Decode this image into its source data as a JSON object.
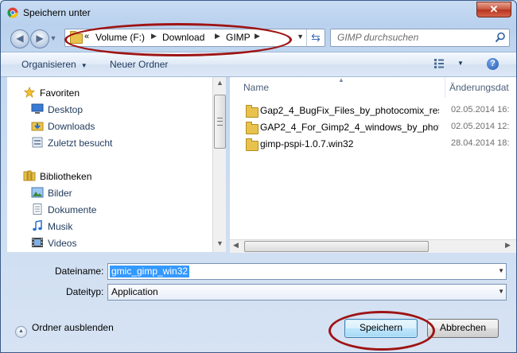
{
  "window": {
    "title": "Speichern unter",
    "close_label": "✕"
  },
  "address": {
    "overflow": "«",
    "crumbs": [
      "Volume (F:)",
      "Download",
      "GIMP"
    ],
    "search_placeholder": "GIMP durchsuchen"
  },
  "toolbar": {
    "organize": "Organisieren",
    "new_folder": "Neuer Ordner",
    "help": "?"
  },
  "nav": {
    "favorites_label": "Favoriten",
    "favorites": [
      "Desktop",
      "Downloads",
      "Zuletzt besucht"
    ],
    "libraries_label": "Bibliotheken",
    "libraries": [
      "Bilder",
      "Dokumente",
      "Musik",
      "Videos"
    ]
  },
  "files": {
    "columns": {
      "name": "Name",
      "modified": "Änderungsdat"
    },
    "rows": [
      {
        "name": "Gap2_4_BugFix_Files_by_photocomix_res...",
        "date": "02.05.2014 16:"
      },
      {
        "name": "GAP2_4_For_Gimp2_4_windows_by_phot...",
        "date": "02.05.2014 12:"
      },
      {
        "name": "gimp-pspi-1.0.7.win32",
        "date": "28.04.2014 18:"
      }
    ]
  },
  "form": {
    "filename_label": "Dateiname:",
    "filename_value": "gmic_gimp_win32",
    "filetype_label": "Dateityp:",
    "filetype_value": "Application"
  },
  "footer": {
    "hide_folders": "Ordner ausblenden",
    "save": "Speichern",
    "cancel": "Abbrechen"
  },
  "colors": {
    "annotation": "#9e1414",
    "accent": "#3399ff"
  }
}
